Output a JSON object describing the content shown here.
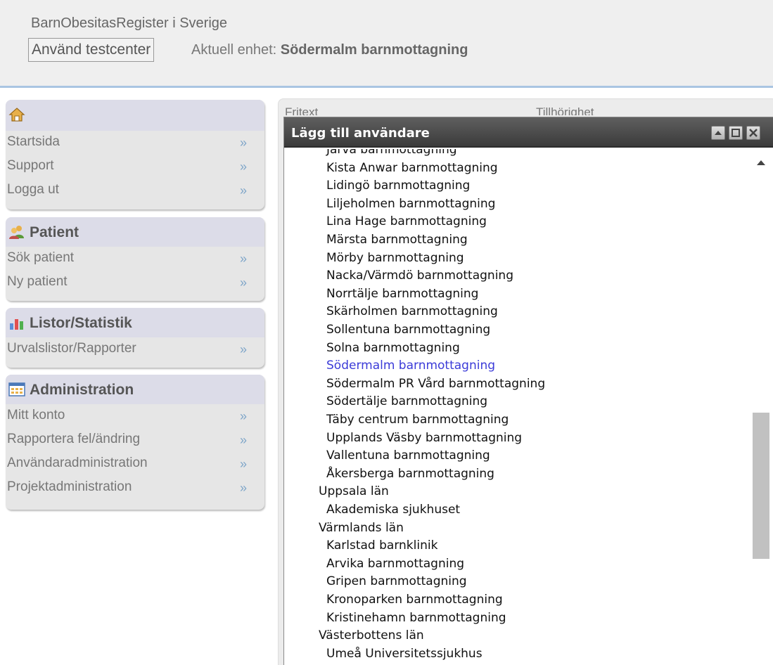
{
  "header": {
    "site_title": "BarnObesitasRegister i Sverige",
    "testcenter_button": "Använd testcenter",
    "unit_label": "Aktuell enhet: ",
    "unit_value": "Södermalm barnmottagning"
  },
  "sidebar": {
    "home": {
      "icon": "home-icon",
      "items": [
        {
          "label": "Startsida"
        },
        {
          "label": "Support"
        },
        {
          "label": "Logga ut"
        }
      ]
    },
    "patient": {
      "icon": "users-icon",
      "title": "Patient",
      "items": [
        {
          "label": "Sök patient"
        },
        {
          "label": "Ny patient"
        }
      ]
    },
    "statistics": {
      "icon": "bar-chart-icon",
      "title": "Listor/Statistik",
      "items": [
        {
          "label": "Urvalslistor/Rapporter"
        }
      ]
    },
    "administration": {
      "icon": "table-icon",
      "title": "Administration",
      "items": [
        {
          "label": "Mitt konto"
        },
        {
          "label": "Rapportera fel/ändring"
        },
        {
          "label": "Användaradministration"
        },
        {
          "label": "Projektadministration"
        }
      ]
    },
    "item_arrow": "»"
  },
  "content": {
    "col1_label": "Fritext",
    "col2_label": "Tillhörighet"
  },
  "dialog": {
    "title": "Lägg till användare",
    "buttons": [
      "collapse-icon",
      "maximize-icon",
      "close-icon"
    ],
    "items": [
      {
        "text": "Järva barnmottagning",
        "indent": 1
      },
      {
        "text": "Kista Anwar barnmottagning",
        "indent": 1
      },
      {
        "text": "Lidingö barnmottagning",
        "indent": 1
      },
      {
        "text": "Liljeholmen barnmottagning",
        "indent": 1
      },
      {
        "text": "Lina Hage barnmottagning",
        "indent": 1
      },
      {
        "text": "Märsta barnmottagning",
        "indent": 1
      },
      {
        "text": "Mörby barnmottagning",
        "indent": 1
      },
      {
        "text": "Nacka/Värmdö barnmottagning",
        "indent": 1
      },
      {
        "text": "Norrtälje barnmottagning",
        "indent": 1
      },
      {
        "text": "Skärholmen barnmottagning",
        "indent": 1
      },
      {
        "text": "Sollentuna barnmottagning",
        "indent": 1
      },
      {
        "text": "Solna barnmottagning",
        "indent": 1
      },
      {
        "text": "Södermalm barnmottagning",
        "indent": 1,
        "selected": true
      },
      {
        "text": "Södermalm PR Vård barnmottagning",
        "indent": 1
      },
      {
        "text": "Södertälje barnmottagning",
        "indent": 1
      },
      {
        "text": "Täby centrum barnmottagning",
        "indent": 1
      },
      {
        "text": "Upplands Väsby barnmottagning",
        "indent": 1
      },
      {
        "text": "Vallentuna barnmottagning",
        "indent": 1
      },
      {
        "text": "Åkersberga barnmottagning",
        "indent": 1
      },
      {
        "text": "Uppsala län",
        "indent": 0
      },
      {
        "text": "Akademiska sjukhuset",
        "indent": 1
      },
      {
        "text": "Värmlands län",
        "indent": 0
      },
      {
        "text": "Karlstad barnklinik",
        "indent": 1
      },
      {
        "text": "Arvika barnmottagning",
        "indent": 1
      },
      {
        "text": "Gripen barnmottagning",
        "indent": 1
      },
      {
        "text": "Kronoparken barnmottagning",
        "indent": 1
      },
      {
        "text": "Kristinehamn barnmottagning",
        "indent": 1
      },
      {
        "text": "Västerbottens län",
        "indent": 0
      },
      {
        "text": "Umeå Universitetssjukhus",
        "indent": 1
      }
    ]
  }
}
